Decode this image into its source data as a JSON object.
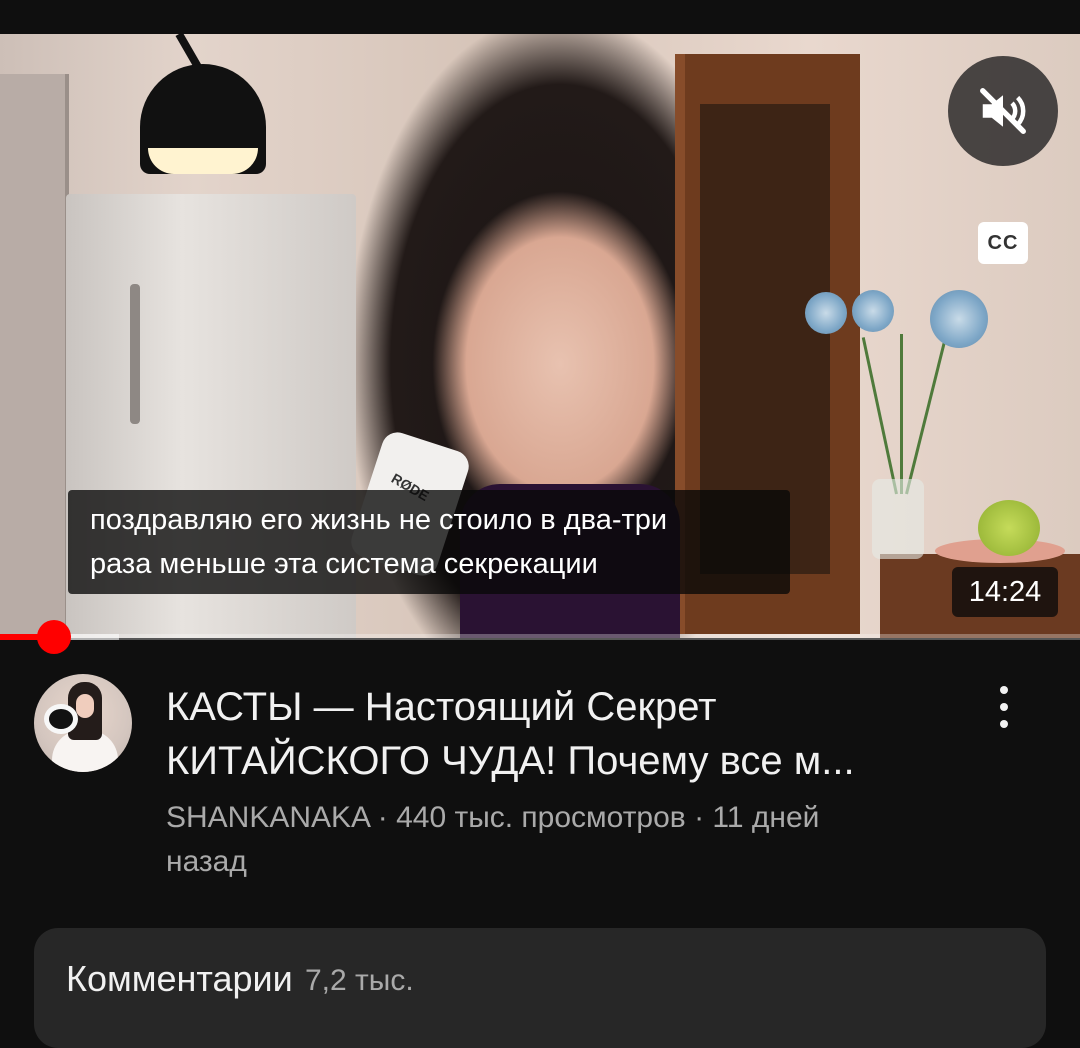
{
  "player": {
    "subtitle_line1": "поздравляю его жизнь не стоило в два-три",
    "subtitle_line2": "раза меньше эта система секрекации",
    "duration": "14:24",
    "cc_label": "CC",
    "mic_brand": "RØDE",
    "muted": true,
    "progress_played_fraction": 0.05,
    "progress_buffered_fraction": 0.11
  },
  "video": {
    "title_line1": "КАСТЫ — Настоящий Секрет",
    "title_line2": "КИТАЙСКОГО ЧУДА! Почему все м...",
    "meta_line1": "SHANKANAKA · 440 тыс. просмотров · 11 дней",
    "meta_line2": "назад"
  },
  "comments": {
    "title": "Комментарии",
    "count": "7,2 тыс."
  },
  "colors": {
    "accent": "#ff0000",
    "background": "#0f0f0f",
    "card": "#272727",
    "secondary_text": "#aaaaaa"
  },
  "icons": [
    "volume-muted-icon",
    "closed-captions-icon",
    "more-vertical-icon"
  ]
}
